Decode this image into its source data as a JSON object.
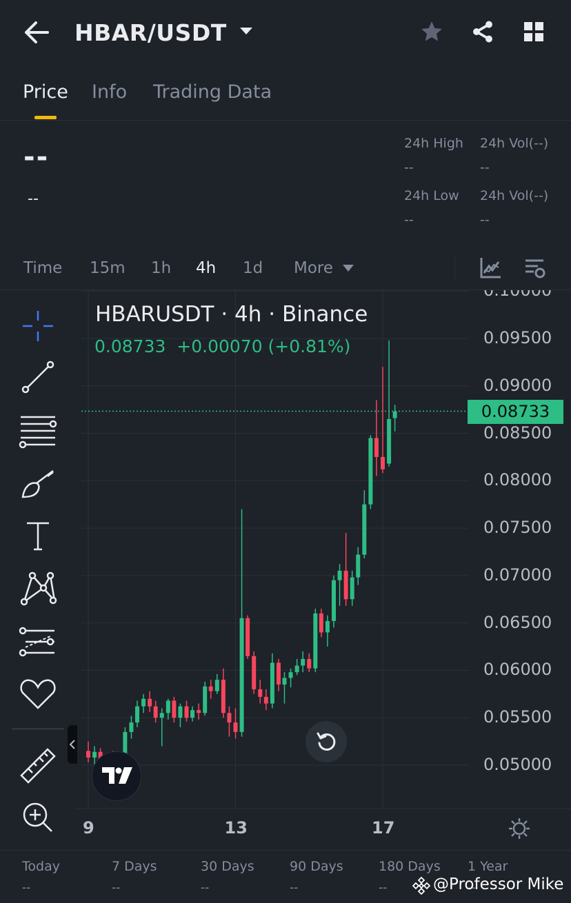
{
  "header": {
    "pair": "HBAR/USDT",
    "back_icon": "back-arrow-icon",
    "dropdown_icon": "caret-down-icon",
    "star_icon": "star-icon",
    "share_icon": "share-icon",
    "grid_icon": "grid-icon"
  },
  "tabs": [
    {
      "label": "Price",
      "active": true
    },
    {
      "label": "Info",
      "active": false
    },
    {
      "label": "Trading Data",
      "active": false
    }
  ],
  "ticker": {
    "last_price": "--",
    "change": "--",
    "high_label": "24h High",
    "high_value": "--",
    "low_label": "24h Low",
    "low_value": "--",
    "vol1_label": "24h Vol(--)",
    "vol1_value": "--",
    "vol2_label": "24h Vol(--)",
    "vol2_value": "--"
  },
  "intervals": {
    "items": [
      "Time",
      "15m",
      "1h",
      "4h",
      "1d",
      "More"
    ],
    "active": "4h"
  },
  "legend": {
    "title": "HBARUSDT · 4h · Binance",
    "values": "0.08733  +0.00070 (+0.81%)"
  },
  "current_price_tag": "0.08733",
  "colors": {
    "up": "#2ebd85",
    "down": "#f6465d",
    "accent": "#f0b90b",
    "background": "#1e2229"
  },
  "chart_data": {
    "type": "candlestick",
    "symbol": "HBARUSDT",
    "interval": "4h",
    "exchange": "Binance",
    "last": 0.08733,
    "y_ticks": [
      "0.10000",
      "0.09500",
      "0.09000",
      "0.08500",
      "0.08000",
      "0.07500",
      "0.07000",
      "0.06500",
      "0.06000",
      "0.05500",
      "0.05000"
    ],
    "x_ticks": [
      "9",
      "13",
      "17"
    ],
    "ylim": [
      0.0455,
      0.1
    ],
    "candles": [
      {
        "x": 9.0,
        "o": 0.0515,
        "h": 0.0525,
        "l": 0.0503,
        "c": 0.0508
      },
      {
        "x": 9.17,
        "o": 0.0508,
        "h": 0.052,
        "l": 0.05,
        "c": 0.0514
      },
      {
        "x": 9.33,
        "o": 0.0514,
        "h": 0.0518,
        "l": 0.05,
        "c": 0.0502
      },
      {
        "x": 9.5,
        "o": 0.0502,
        "h": 0.0512,
        "l": 0.0498,
        "c": 0.051
      },
      {
        "x": 9.67,
        "o": 0.051,
        "h": 0.0515,
        "l": 0.05,
        "c": 0.0506
      },
      {
        "x": 9.83,
        "o": 0.0506,
        "h": 0.0514,
        "l": 0.05,
        "c": 0.0512
      },
      {
        "x": 10.0,
        "o": 0.0512,
        "h": 0.054,
        "l": 0.0508,
        "c": 0.0535
      },
      {
        "x": 10.17,
        "o": 0.0535,
        "h": 0.0552,
        "l": 0.0528,
        "c": 0.0545
      },
      {
        "x": 10.33,
        "o": 0.0545,
        "h": 0.0568,
        "l": 0.054,
        "c": 0.0562
      },
      {
        "x": 10.5,
        "o": 0.0562,
        "h": 0.0575,
        "l": 0.0555,
        "c": 0.057
      },
      {
        "x": 10.67,
        "o": 0.057,
        "h": 0.0578,
        "l": 0.0556,
        "c": 0.0562
      },
      {
        "x": 10.83,
        "o": 0.0562,
        "h": 0.0568,
        "l": 0.0545,
        "c": 0.055
      },
      {
        "x": 11.0,
        "o": 0.055,
        "h": 0.056,
        "l": 0.052,
        "c": 0.0555
      },
      {
        "x": 11.17,
        "o": 0.0555,
        "h": 0.057,
        "l": 0.0548,
        "c": 0.0568
      },
      {
        "x": 11.33,
        "o": 0.0568,
        "h": 0.0572,
        "l": 0.0545,
        "c": 0.055
      },
      {
        "x": 11.5,
        "o": 0.055,
        "h": 0.0565,
        "l": 0.054,
        "c": 0.0562
      },
      {
        "x": 11.67,
        "o": 0.0562,
        "h": 0.0568,
        "l": 0.0546,
        "c": 0.055
      },
      {
        "x": 11.83,
        "o": 0.055,
        "h": 0.0562,
        "l": 0.0546,
        "c": 0.0558
      },
      {
        "x": 12.0,
        "o": 0.0558,
        "h": 0.0565,
        "l": 0.0548,
        "c": 0.0555
      },
      {
        "x": 12.17,
        "o": 0.0555,
        "h": 0.0588,
        "l": 0.0552,
        "c": 0.0583
      },
      {
        "x": 12.33,
        "o": 0.0583,
        "h": 0.059,
        "l": 0.057,
        "c": 0.0578
      },
      {
        "x": 12.5,
        "o": 0.0578,
        "h": 0.0596,
        "l": 0.0575,
        "c": 0.059
      },
      {
        "x": 12.67,
        "o": 0.059,
        "h": 0.0602,
        "l": 0.055,
        "c": 0.0555
      },
      {
        "x": 12.83,
        "o": 0.0555,
        "h": 0.0562,
        "l": 0.053,
        "c": 0.0545
      },
      {
        "x": 13.0,
        "o": 0.0545,
        "h": 0.056,
        "l": 0.0528,
        "c": 0.0535
      },
      {
        "x": 13.17,
        "o": 0.0535,
        "h": 0.077,
        "l": 0.053,
        "c": 0.0655
      },
      {
        "x": 13.33,
        "o": 0.0655,
        "h": 0.0658,
        "l": 0.0612,
        "c": 0.0615
      },
      {
        "x": 13.5,
        "o": 0.0615,
        "h": 0.062,
        "l": 0.0575,
        "c": 0.058
      },
      {
        "x": 13.67,
        "o": 0.058,
        "h": 0.059,
        "l": 0.0565,
        "c": 0.0572
      },
      {
        "x": 13.83,
        "o": 0.0572,
        "h": 0.058,
        "l": 0.0558,
        "c": 0.0565
      },
      {
        "x": 14.0,
        "o": 0.0565,
        "h": 0.0618,
        "l": 0.056,
        "c": 0.0608
      },
      {
        "x": 14.17,
        "o": 0.0608,
        "h": 0.0612,
        "l": 0.0578,
        "c": 0.0585
      },
      {
        "x": 14.33,
        "o": 0.0585,
        "h": 0.0598,
        "l": 0.0565,
        "c": 0.0592
      },
      {
        "x": 14.5,
        "o": 0.0592,
        "h": 0.0602,
        "l": 0.0582,
        "c": 0.0598
      },
      {
        "x": 14.67,
        "o": 0.0598,
        "h": 0.0612,
        "l": 0.0595,
        "c": 0.0605
      },
      {
        "x": 14.83,
        "o": 0.0605,
        "h": 0.062,
        "l": 0.0598,
        "c": 0.0612
      },
      {
        "x": 15.0,
        "o": 0.0612,
        "h": 0.0618,
        "l": 0.0598,
        "c": 0.0602
      },
      {
        "x": 15.17,
        "o": 0.0602,
        "h": 0.0665,
        "l": 0.0598,
        "c": 0.066
      },
      {
        "x": 15.33,
        "o": 0.066,
        "h": 0.0665,
        "l": 0.0635,
        "c": 0.064
      },
      {
        "x": 15.5,
        "o": 0.064,
        "h": 0.0658,
        "l": 0.0625,
        "c": 0.0652
      },
      {
        "x": 15.67,
        "o": 0.0652,
        "h": 0.07,
        "l": 0.0645,
        "c": 0.0695
      },
      {
        "x": 15.83,
        "o": 0.0695,
        "h": 0.0712,
        "l": 0.0668,
        "c": 0.0705
      },
      {
        "x": 16.0,
        "o": 0.0705,
        "h": 0.0745,
        "l": 0.0668,
        "c": 0.0675
      },
      {
        "x": 16.17,
        "o": 0.0675,
        "h": 0.0705,
        "l": 0.0668,
        "c": 0.0698
      },
      {
        "x": 16.33,
        "o": 0.0698,
        "h": 0.073,
        "l": 0.069,
        "c": 0.0722
      },
      {
        "x": 16.5,
        "o": 0.0722,
        "h": 0.079,
        "l": 0.0718,
        "c": 0.0775
      },
      {
        "x": 16.67,
        "o": 0.0775,
        "h": 0.0848,
        "l": 0.077,
        "c": 0.0845
      },
      {
        "x": 16.83,
        "o": 0.0845,
        "h": 0.0885,
        "l": 0.0805,
        "c": 0.0825
      },
      {
        "x": 17.0,
        "o": 0.0825,
        "h": 0.092,
        "l": 0.0808,
        "c": 0.0812
      },
      {
        "x": 17.17,
        "o": 0.0818,
        "h": 0.0948,
        "l": 0.0815,
        "c": 0.0865
      },
      {
        "x": 17.33,
        "o": 0.0866,
        "h": 0.088,
        "l": 0.0852,
        "c": 0.0873
      }
    ]
  },
  "perf": [
    {
      "label": "Today",
      "value": "--"
    },
    {
      "label": "7 Days",
      "value": "--"
    },
    {
      "label": "30 Days",
      "value": "--"
    },
    {
      "label": "90 Days",
      "value": "--"
    },
    {
      "label": "180 Days",
      "value": "--"
    },
    {
      "label": "1 Year",
      "value": "--"
    }
  ],
  "watermark": "@Professor Mike"
}
